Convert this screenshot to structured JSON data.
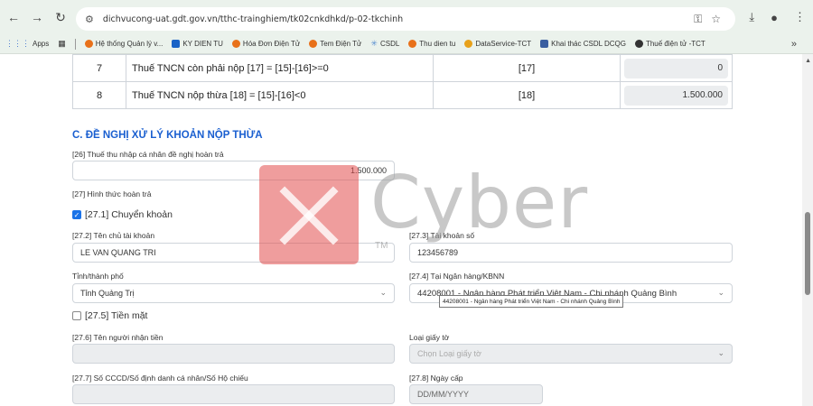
{
  "browser": {
    "url": "dichvucong-uat.gdt.gov.vn/tthc-trainghiem/tk02cnkdhkd/p-02-tkchinh",
    "bookmarks": [
      {
        "label": "Apps",
        "color": "#4a7bd0"
      },
      {
        "label": "Hệ thống Quản lý v...",
        "color": "#e8711a"
      },
      {
        "label": "KY DIEN TU",
        "color": "#1a63c6"
      },
      {
        "label": "Hóa Đơn Điện Tử",
        "color": "#e8711a"
      },
      {
        "label": "Tem Điện Tử",
        "color": "#e8711a"
      },
      {
        "label": "CSDL",
        "color": "#5a8fd0"
      },
      {
        "label": "Thu dien tu",
        "color": "#e8711a"
      },
      {
        "label": "DataService-TCT",
        "color": "#e8a11a"
      },
      {
        "label": "Khai thác CSDL DCQG",
        "color": "#3a5fa0"
      },
      {
        "label": "Thuế điện tử -TCT",
        "color": "#333333"
      }
    ],
    "more_label": "»"
  },
  "table": {
    "rows": [
      {
        "num": "7",
        "desc": "Thuế TNCN còn phải nộp [17] = [15]-[16]>=0",
        "code": "[17]",
        "value": "0"
      },
      {
        "num": "8",
        "desc": "Thuế TNCN nộp thừa [18] = [15]-[16]<0",
        "code": "[18]",
        "value": "1.500.000"
      }
    ]
  },
  "section_c": {
    "title": "C. ĐỀ NGHỊ XỬ LÝ KHOẢN NỘP THỪA",
    "refund_label": "[26] Thuế thu nhập cá nhân đề nghị hoàn trả",
    "refund_value": "1.500.000",
    "method_label": "[27] Hình thức hoàn trả",
    "transfer_label": "[27.1] Chuyển khoản",
    "transfer_checked": true,
    "account_owner_label": "[27.2] Tên chủ tài khoản",
    "account_owner_value": "LE VAN QUANG TRI",
    "account_number_label": "[27.3] Tài khoản số",
    "account_number_value": "123456789",
    "province_label": "Tỉnh/thành phố",
    "province_value": "Tỉnh Quảng Trị",
    "bank_label": "[27.4] Tại Ngân hàng/KBNN",
    "bank_value": "44208001 - Ngân hàng Phát triển Việt Nam - Chi nhánh Quảng Bình",
    "bank_tooltip": "44208001 - Ngân hàng Phát triển Việt Nam - Chi nhánh Quảng Bình",
    "cash_label": "[27.5] Tiền mặt",
    "cash_checked": false,
    "receiver_label": "[27.6] Tên người nhận tiền",
    "doc_type_label": "Loại giấy tờ",
    "doc_type_placeholder": "Chọn Loại giấy tờ",
    "id_label": "[27.7] Số CCCD/Số định danh cá nhân/Số Hộ chiếu",
    "issue_date_label": "[27.8] Ngày cấp",
    "issue_date_placeholder": "DD/MM/YYYY"
  },
  "watermark": {
    "text": "Cyber",
    "tm": "TM"
  }
}
